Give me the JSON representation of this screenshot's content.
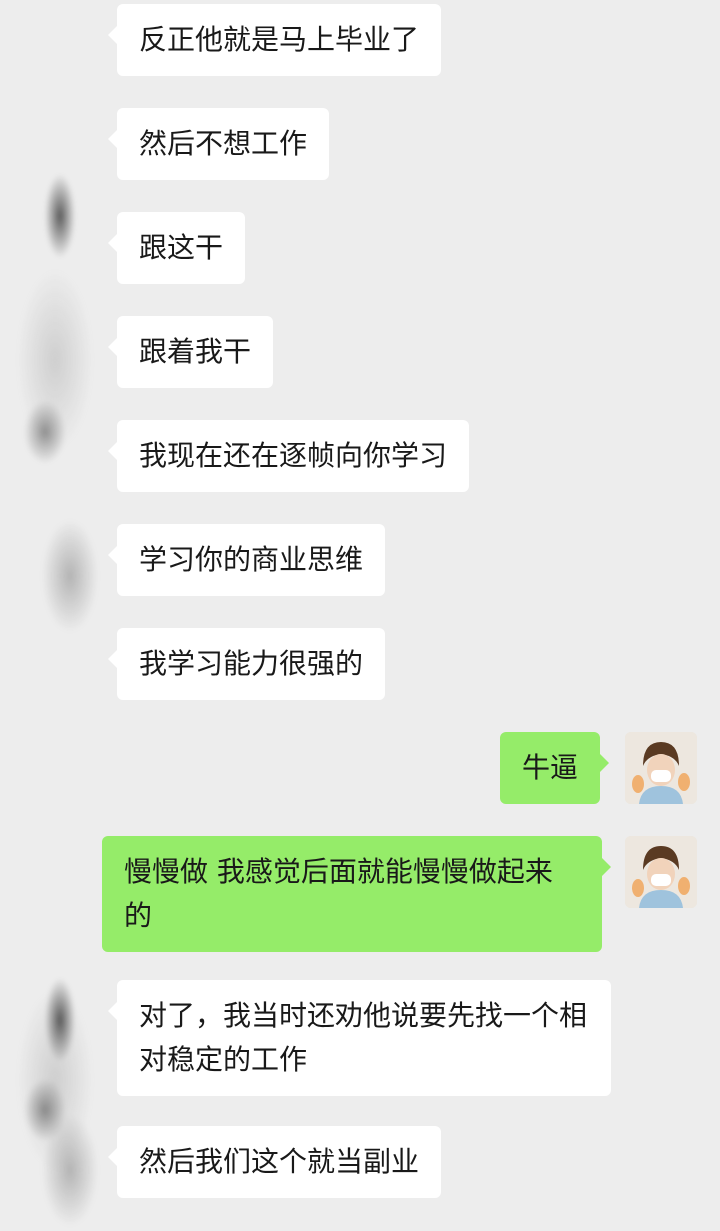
{
  "messages": [
    {
      "side": "in",
      "text": "反正他就是马上毕业了"
    },
    {
      "side": "in",
      "text": "然后不想工作"
    },
    {
      "side": "in",
      "text": "跟这干"
    },
    {
      "side": "in",
      "text": "跟着我干"
    },
    {
      "side": "in",
      "text": "我现在还在逐帧向你学习"
    },
    {
      "side": "in",
      "text": "学习你的商业思维"
    },
    {
      "side": "in",
      "text": "我学习能力很强的"
    },
    {
      "side": "out",
      "text": "牛逼"
    },
    {
      "side": "out",
      "text": "慢慢做 我感觉后面就能慢慢做起来的"
    },
    {
      "side": "in",
      "text": "对了，我当时还劝他说要先找一个相对稳定的工作"
    },
    {
      "side": "in",
      "text": "然后我们这个就当副业"
    }
  ],
  "colors": {
    "background": "#ededed",
    "incoming_bubble": "#ffffff",
    "outgoing_bubble": "#95ec69"
  },
  "icons": {
    "sender_avatar": "blurred-avatar-icon",
    "own_avatar": "user-avatar-icon"
  }
}
